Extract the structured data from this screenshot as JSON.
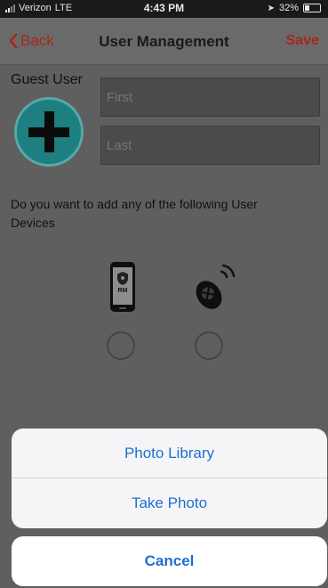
{
  "status_bar": {
    "carrier": "Verizon",
    "network": "LTE",
    "time": "4:43 PM",
    "battery": "32%",
    "battery_level": 0.32
  },
  "nav": {
    "back_label": "Back",
    "title": "User Management",
    "save_label": "Save"
  },
  "form": {
    "guest_label": "Guest User",
    "first_placeholder": "First",
    "last_placeholder": "Last",
    "question": "Do you want to add any of the following User Devices",
    "phone_badge": "RM"
  },
  "action_sheet": {
    "photo_library": "Photo Library",
    "take_photo": "Take Photo",
    "cancel": "Cancel"
  },
  "colors": {
    "accent_red": "#a8271b",
    "ios_blue": "#1e6fcf",
    "avatar_teal": "#1d7f80"
  }
}
